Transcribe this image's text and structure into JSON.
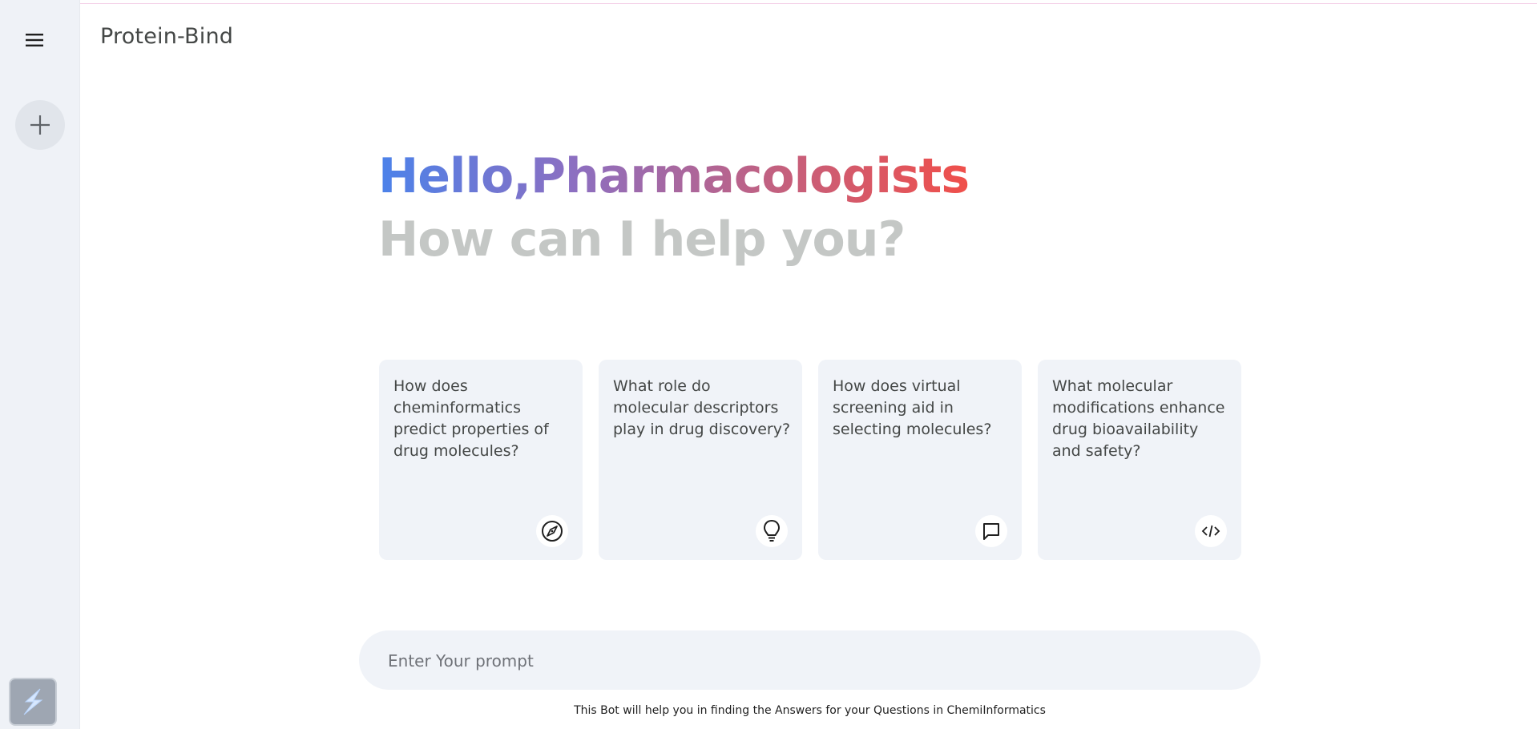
{
  "app": {
    "title": "Protein-Bind"
  },
  "greeting": {
    "hello": "Hello,Pharmacologists",
    "subtitle": "How can I help you?"
  },
  "cards": [
    {
      "text": "How does cheminformatics predict properties of drug molecules?",
      "icon": "compass-icon"
    },
    {
      "text": "What role do molecular descriptors play in drug discovery?",
      "icon": "lightbulb-icon"
    },
    {
      "text": "How does virtual screening aid in selecting molecules?",
      "icon": "chat-bubble-icon"
    },
    {
      "text": "What molecular modifications enhance drug bioavailability and safety?",
      "icon": "code-icon"
    }
  ],
  "prompt": {
    "placeholder": "Enter Your prompt",
    "value": ""
  },
  "footer": {
    "note": "This Bot will help you in finding the Answers for your Questions in ChemiInformatics"
  },
  "colors": {
    "sidebar_bg": "#eff2f7",
    "card_bg": "#f0f3f8",
    "gradient_start": "#4b82ea",
    "gradient_end": "#f04f4a",
    "subtitle_gray": "#c4c7c5"
  }
}
